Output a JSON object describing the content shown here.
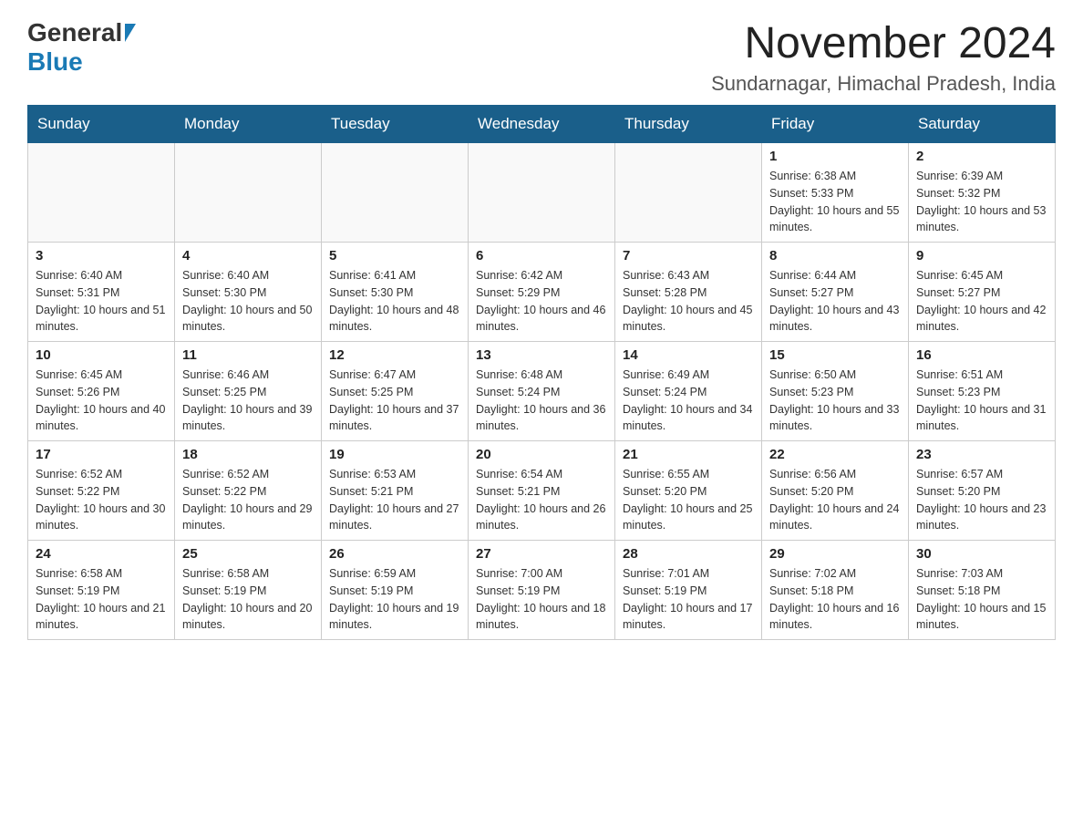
{
  "logo": {
    "text_general": "General",
    "text_blue": "Blue"
  },
  "title": {
    "month": "November 2024",
    "location": "Sundarnagar, Himachal Pradesh, India"
  },
  "weekdays": [
    "Sunday",
    "Monday",
    "Tuesday",
    "Wednesday",
    "Thursday",
    "Friday",
    "Saturday"
  ],
  "weeks": [
    [
      {
        "day": "",
        "info": ""
      },
      {
        "day": "",
        "info": ""
      },
      {
        "day": "",
        "info": ""
      },
      {
        "day": "",
        "info": ""
      },
      {
        "day": "",
        "info": ""
      },
      {
        "day": "1",
        "info": "Sunrise: 6:38 AM\nSunset: 5:33 PM\nDaylight: 10 hours and 55 minutes."
      },
      {
        "day": "2",
        "info": "Sunrise: 6:39 AM\nSunset: 5:32 PM\nDaylight: 10 hours and 53 minutes."
      }
    ],
    [
      {
        "day": "3",
        "info": "Sunrise: 6:40 AM\nSunset: 5:31 PM\nDaylight: 10 hours and 51 minutes."
      },
      {
        "day": "4",
        "info": "Sunrise: 6:40 AM\nSunset: 5:30 PM\nDaylight: 10 hours and 50 minutes."
      },
      {
        "day": "5",
        "info": "Sunrise: 6:41 AM\nSunset: 5:30 PM\nDaylight: 10 hours and 48 minutes."
      },
      {
        "day": "6",
        "info": "Sunrise: 6:42 AM\nSunset: 5:29 PM\nDaylight: 10 hours and 46 minutes."
      },
      {
        "day": "7",
        "info": "Sunrise: 6:43 AM\nSunset: 5:28 PM\nDaylight: 10 hours and 45 minutes."
      },
      {
        "day": "8",
        "info": "Sunrise: 6:44 AM\nSunset: 5:27 PM\nDaylight: 10 hours and 43 minutes."
      },
      {
        "day": "9",
        "info": "Sunrise: 6:45 AM\nSunset: 5:27 PM\nDaylight: 10 hours and 42 minutes."
      }
    ],
    [
      {
        "day": "10",
        "info": "Sunrise: 6:45 AM\nSunset: 5:26 PM\nDaylight: 10 hours and 40 minutes."
      },
      {
        "day": "11",
        "info": "Sunrise: 6:46 AM\nSunset: 5:25 PM\nDaylight: 10 hours and 39 minutes."
      },
      {
        "day": "12",
        "info": "Sunrise: 6:47 AM\nSunset: 5:25 PM\nDaylight: 10 hours and 37 minutes."
      },
      {
        "day": "13",
        "info": "Sunrise: 6:48 AM\nSunset: 5:24 PM\nDaylight: 10 hours and 36 minutes."
      },
      {
        "day": "14",
        "info": "Sunrise: 6:49 AM\nSunset: 5:24 PM\nDaylight: 10 hours and 34 minutes."
      },
      {
        "day": "15",
        "info": "Sunrise: 6:50 AM\nSunset: 5:23 PM\nDaylight: 10 hours and 33 minutes."
      },
      {
        "day": "16",
        "info": "Sunrise: 6:51 AM\nSunset: 5:23 PM\nDaylight: 10 hours and 31 minutes."
      }
    ],
    [
      {
        "day": "17",
        "info": "Sunrise: 6:52 AM\nSunset: 5:22 PM\nDaylight: 10 hours and 30 minutes."
      },
      {
        "day": "18",
        "info": "Sunrise: 6:52 AM\nSunset: 5:22 PM\nDaylight: 10 hours and 29 minutes."
      },
      {
        "day": "19",
        "info": "Sunrise: 6:53 AM\nSunset: 5:21 PM\nDaylight: 10 hours and 27 minutes."
      },
      {
        "day": "20",
        "info": "Sunrise: 6:54 AM\nSunset: 5:21 PM\nDaylight: 10 hours and 26 minutes."
      },
      {
        "day": "21",
        "info": "Sunrise: 6:55 AM\nSunset: 5:20 PM\nDaylight: 10 hours and 25 minutes."
      },
      {
        "day": "22",
        "info": "Sunrise: 6:56 AM\nSunset: 5:20 PM\nDaylight: 10 hours and 24 minutes."
      },
      {
        "day": "23",
        "info": "Sunrise: 6:57 AM\nSunset: 5:20 PM\nDaylight: 10 hours and 23 minutes."
      }
    ],
    [
      {
        "day": "24",
        "info": "Sunrise: 6:58 AM\nSunset: 5:19 PM\nDaylight: 10 hours and 21 minutes."
      },
      {
        "day": "25",
        "info": "Sunrise: 6:58 AM\nSunset: 5:19 PM\nDaylight: 10 hours and 20 minutes."
      },
      {
        "day": "26",
        "info": "Sunrise: 6:59 AM\nSunset: 5:19 PM\nDaylight: 10 hours and 19 minutes."
      },
      {
        "day": "27",
        "info": "Sunrise: 7:00 AM\nSunset: 5:19 PM\nDaylight: 10 hours and 18 minutes."
      },
      {
        "day": "28",
        "info": "Sunrise: 7:01 AM\nSunset: 5:19 PM\nDaylight: 10 hours and 17 minutes."
      },
      {
        "day": "29",
        "info": "Sunrise: 7:02 AM\nSunset: 5:18 PM\nDaylight: 10 hours and 16 minutes."
      },
      {
        "day": "30",
        "info": "Sunrise: 7:03 AM\nSunset: 5:18 PM\nDaylight: 10 hours and 15 minutes."
      }
    ]
  ]
}
